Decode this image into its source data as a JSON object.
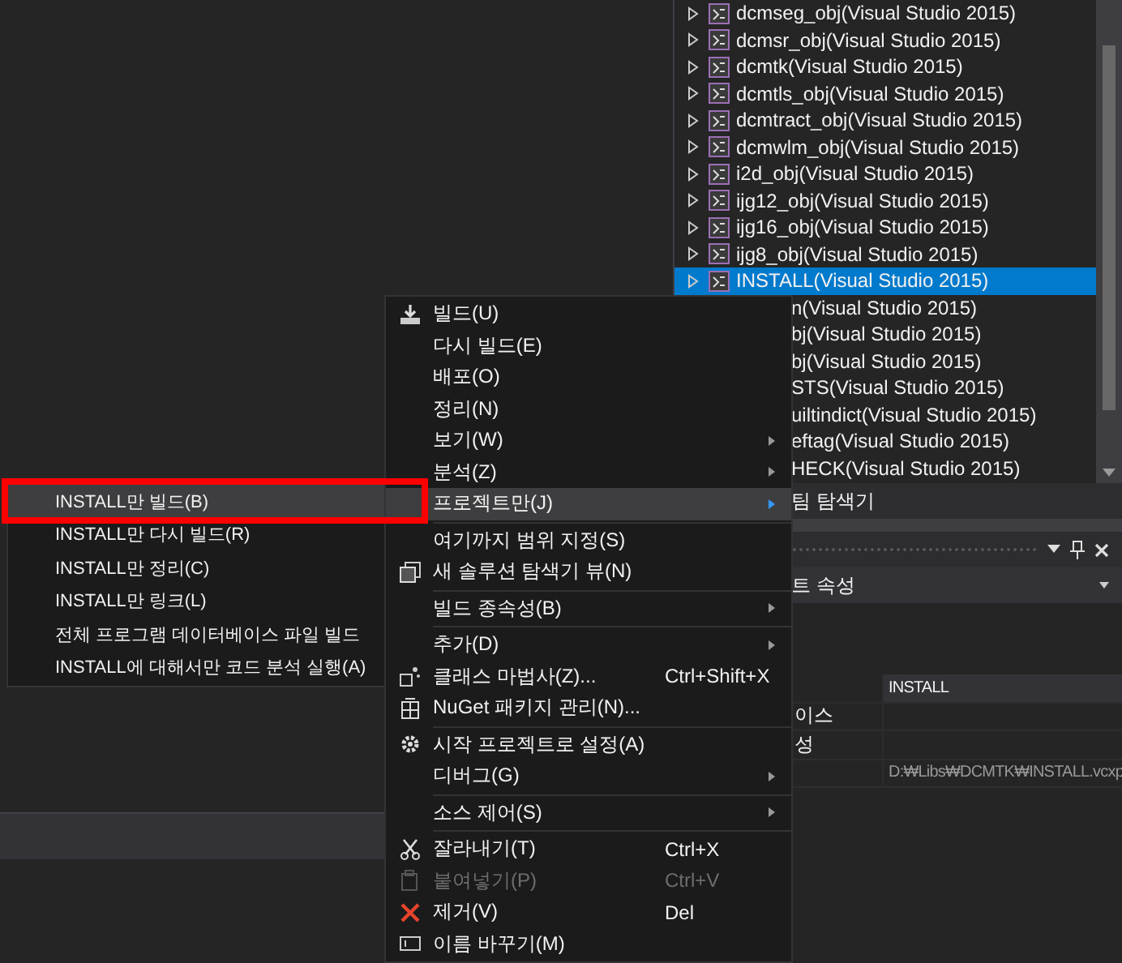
{
  "solution_explorer": {
    "items": [
      {
        "label": "dcmseg_obj(Visual Studio 2015)",
        "kind": "project",
        "selected": false
      },
      {
        "label": "dcmsr_obj(Visual Studio 2015)",
        "kind": "project",
        "selected": false
      },
      {
        "label": "dcmtk(Visual Studio 2015)",
        "kind": "project",
        "selected": false
      },
      {
        "label": "dcmtls_obj(Visual Studio 2015)",
        "kind": "project",
        "selected": false
      },
      {
        "label": "dcmtract_obj(Visual Studio 2015)",
        "kind": "project",
        "selected": false
      },
      {
        "label": "dcmwlm_obj(Visual Studio 2015)",
        "kind": "project",
        "selected": false
      },
      {
        "label": "i2d_obj(Visual Studio 2015)",
        "kind": "project",
        "selected": false
      },
      {
        "label": "ijg12_obj(Visual Studio 2015)",
        "kind": "project",
        "selected": false
      },
      {
        "label": "ijg16_obj(Visual Studio 2015)",
        "kind": "project",
        "selected": false
      },
      {
        "label": "ijg8_obj(Visual Studio 2015)",
        "kind": "project",
        "selected": false
      },
      {
        "label": "INSTALL(Visual Studio 2015)",
        "kind": "project",
        "selected": true
      },
      {
        "label": "n(Visual Studio 2015)",
        "kind": "partial",
        "selected": false
      },
      {
        "label": "bj(Visual Studio 2015)",
        "kind": "partial",
        "selected": false
      },
      {
        "label": "bj(Visual Studio 2015)",
        "kind": "partial",
        "selected": false
      },
      {
        "label": "STS(Visual Studio 2015)",
        "kind": "partial",
        "selected": false
      },
      {
        "label": "uiltindict(Visual Studio 2015)",
        "kind": "partial",
        "selected": false
      },
      {
        "label": "eftag(Visual Studio 2015)",
        "kind": "partial",
        "selected": false
      },
      {
        "label": "HECK(Visual Studio 2015)",
        "kind": "partial",
        "selected": false
      }
    ]
  },
  "tab": {
    "label": "팀 탐색기"
  },
  "properties": {
    "title": "트 속성",
    "rows": [
      {
        "value": "INSTALL"
      },
      {
        "name": "이스"
      },
      {
        "name": "성"
      },
      {
        "value": "D:₩Libs₩DCMTK₩INSTALL.vcxp"
      }
    ]
  },
  "context_menu": {
    "items": [
      {
        "kind": "item",
        "label": "빌드(U)",
        "selected": false,
        "disabled": false
      },
      {
        "kind": "item",
        "label": "다시 빌드(E)",
        "selected": false,
        "disabled": false
      },
      {
        "kind": "item",
        "label": "배포(O)",
        "selected": false,
        "disabled": false
      },
      {
        "kind": "item",
        "label": "정리(N)",
        "selected": false,
        "disabled": false
      },
      {
        "kind": "item",
        "label": "보기(W)",
        "submenu": true,
        "selected": false,
        "disabled": false
      },
      {
        "kind": "item",
        "label": "분석(Z)",
        "submenu": true,
        "selected": false,
        "disabled": false
      },
      {
        "kind": "item",
        "label": "프로젝트만(J)",
        "submenu": true,
        "selected": true,
        "disabled": false
      },
      {
        "kind": "separator"
      },
      {
        "kind": "item",
        "label": "여기까지 범위 지정(S)",
        "selected": false,
        "disabled": false
      },
      {
        "kind": "item",
        "label": "새 솔루션 탐색기 뷰(N)",
        "selected": false,
        "disabled": false
      },
      {
        "kind": "separator"
      },
      {
        "kind": "item",
        "label": "빌드 종속성(B)",
        "submenu": true,
        "selected": false,
        "disabled": false
      },
      {
        "kind": "separator"
      },
      {
        "kind": "item",
        "label": "추가(D)",
        "submenu": true,
        "selected": false,
        "disabled": false
      },
      {
        "kind": "item",
        "label": "클래스 마법사(Z)...",
        "shortcut": "Ctrl+Shift+X",
        "selected": false,
        "disabled": false
      },
      {
        "kind": "item",
        "label": "NuGet 패키지 관리(N)...",
        "selected": false,
        "disabled": false
      },
      {
        "kind": "separator"
      },
      {
        "kind": "item",
        "label": "시작 프로젝트로 설정(A)",
        "selected": false,
        "disabled": false
      },
      {
        "kind": "item",
        "label": "디버그(G)",
        "submenu": true,
        "selected": false,
        "disabled": false
      },
      {
        "kind": "separator"
      },
      {
        "kind": "item",
        "label": "소스 제어(S)",
        "submenu": true,
        "selected": false,
        "disabled": false
      },
      {
        "kind": "separator"
      },
      {
        "kind": "item",
        "label": "잘라내기(T)",
        "shortcut": "Ctrl+X",
        "selected": false,
        "disabled": false
      },
      {
        "kind": "item",
        "label": "붙여넣기(P)",
        "shortcut": "Ctrl+V",
        "selected": false,
        "disabled": true
      },
      {
        "kind": "item",
        "label": "제거(V)",
        "shortcut": "Del",
        "selected": false,
        "disabled": false
      },
      {
        "kind": "item",
        "label": "이름 바꾸기(M)",
        "selected": false,
        "disabled": false
      }
    ]
  },
  "submenu": {
    "items": [
      {
        "kind": "item",
        "label": "INSTALL만 빌드(B)",
        "selected": true
      },
      {
        "kind": "item",
        "label": "INSTALL만 다시 빌드(R)",
        "selected": false
      },
      {
        "kind": "item",
        "label": "INSTALL만 정리(C)",
        "selected": false
      },
      {
        "kind": "item",
        "label": "INSTALL만 링크(L)",
        "selected": false
      },
      {
        "kind": "item",
        "label": "전체 프로그램 데이터베이스 파일 빌드",
        "selected": false
      },
      {
        "kind": "item",
        "label": "INSTALL에 대해서만 코드 분석 실행(A)",
        "selected": false
      }
    ]
  }
}
